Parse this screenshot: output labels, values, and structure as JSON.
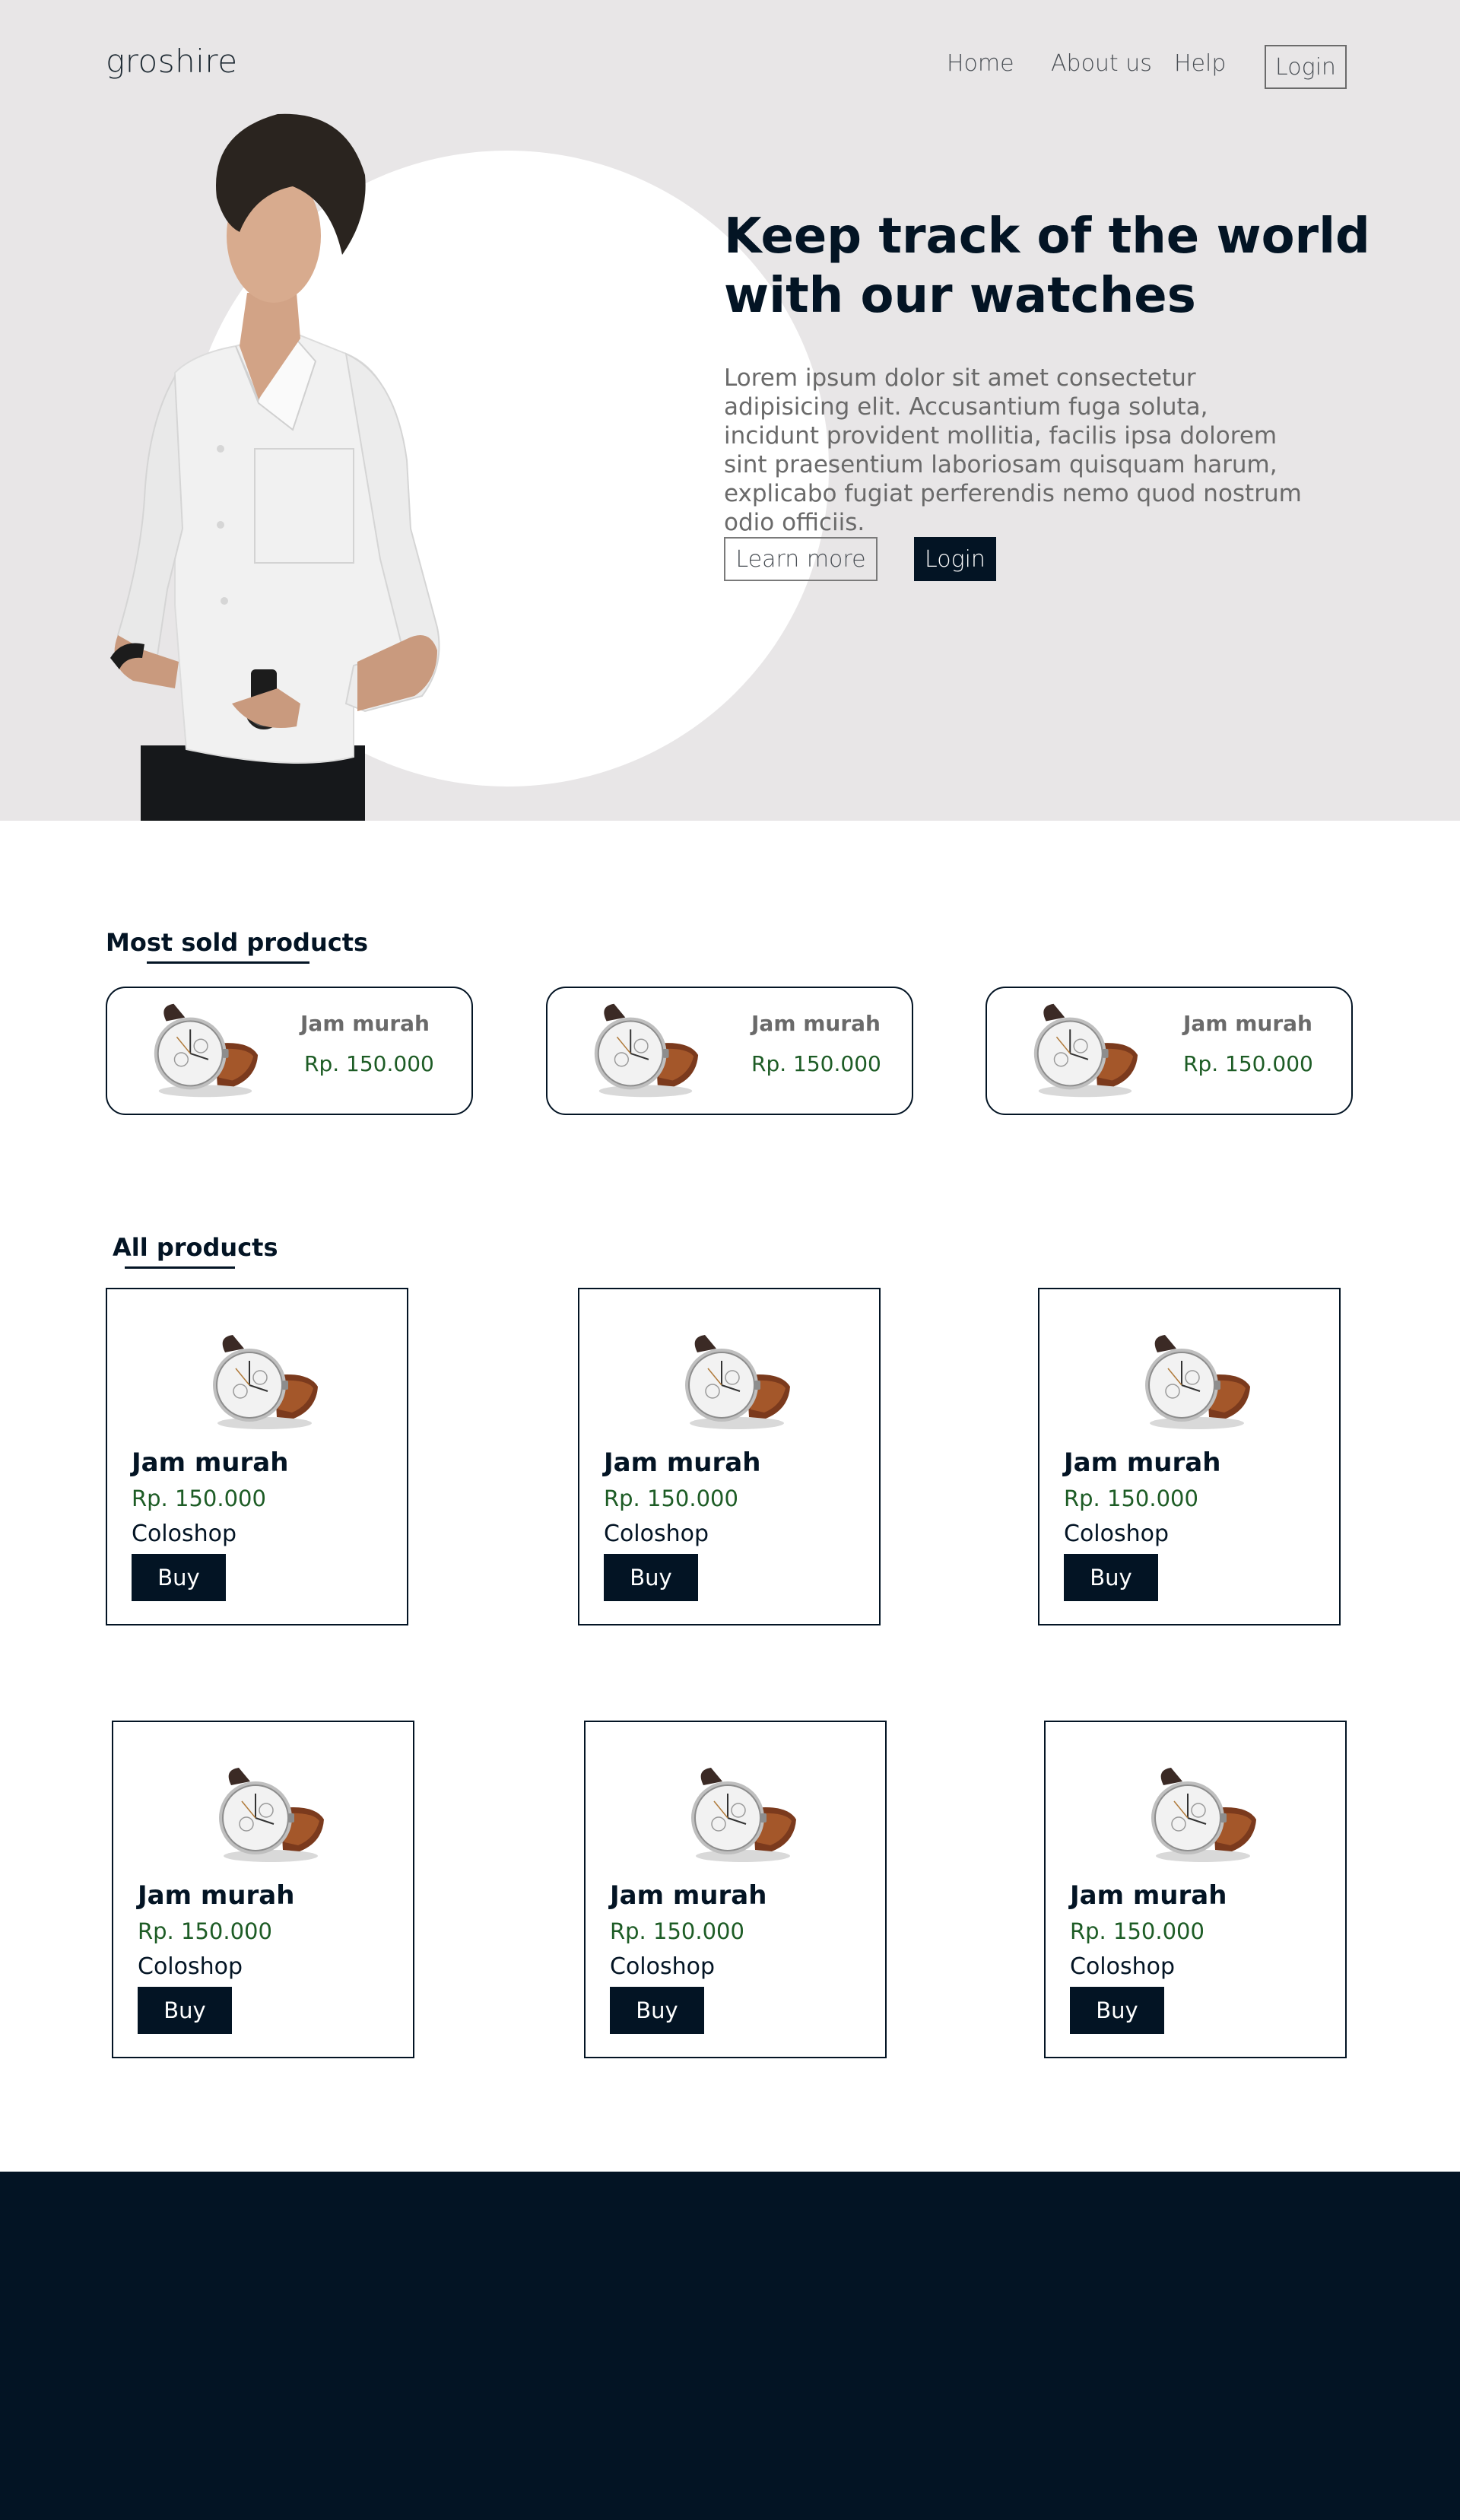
{
  "header": {
    "logo": "groshire",
    "nav": [
      "Home",
      "About us",
      "Help"
    ],
    "login_label": "Login"
  },
  "hero": {
    "title_line1": "Keep track of the world",
    "title_line2": "with our watches",
    "description": "Lorem ipsum dolor sit amet consectetur adipisicing elit. Accusantium fuga soluta, incidunt provident mollitia, facilis ipsa dolorem sint praesentium laboriosam quisquam harum, explicabo fugiat perferendis nemo quod nostrum odio officiis.",
    "learn_more_label": "Learn more",
    "login_label": "Login"
  },
  "most_sold": {
    "title": "Most sold products",
    "items": [
      {
        "name": "Jam murah",
        "price": "Rp. 150.000"
      },
      {
        "name": "Jam murah",
        "price": "Rp. 150.000"
      },
      {
        "name": "Jam murah",
        "price": "Rp. 150.000"
      }
    ]
  },
  "all_products": {
    "title": "All products",
    "items": [
      {
        "name": "Jam murah",
        "price": "Rp. 150.000",
        "shop": "Coloshop",
        "buy_label": "Buy"
      },
      {
        "name": "Jam murah",
        "price": "Rp. 150.000",
        "shop": "Coloshop",
        "buy_label": "Buy"
      },
      {
        "name": "Jam murah",
        "price": "Rp. 150.000",
        "shop": "Coloshop",
        "buy_label": "Buy"
      },
      {
        "name": "Jam murah",
        "price": "Rp. 150.000",
        "shop": "Coloshop",
        "buy_label": "Buy"
      },
      {
        "name": "Jam murah",
        "price": "Rp. 150.000",
        "shop": "Coloshop",
        "buy_label": "Buy"
      },
      {
        "name": "Jam murah",
        "price": "Rp. 150.000",
        "shop": "Coloshop",
        "buy_label": "Buy"
      }
    ]
  },
  "colors": {
    "navy": "#031424",
    "hero_bg": "#e8e6e7",
    "price_green": "#1d5c25"
  }
}
